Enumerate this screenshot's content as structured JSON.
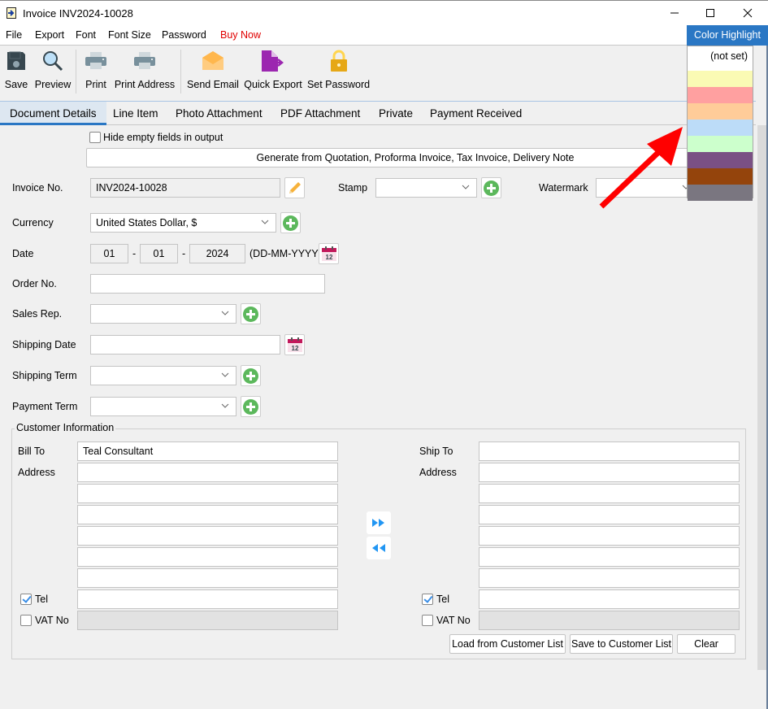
{
  "window": {
    "title": "Invoice INV2024-10028",
    "app_icon": "document-arrow-icon",
    "controls": [
      "minimize",
      "maximize",
      "close"
    ]
  },
  "menubar": {
    "items": [
      "File",
      "Export",
      "Font",
      "Font Size",
      "Password"
    ],
    "buy_now": "Buy Now",
    "color_highlight": "Color Highlight"
  },
  "toolbar": {
    "buttons": [
      {
        "label": "Save",
        "icon": "floppy-disk-icon"
      },
      {
        "label": "Preview",
        "icon": "magnifier-icon"
      },
      {
        "label": "Print",
        "icon": "printer-icon"
      },
      {
        "label": "Print Address",
        "icon": "printer-icon"
      },
      {
        "label": "Send Email",
        "icon": "envelope-icon"
      },
      {
        "label": "Quick Export",
        "icon": "export-document-icon"
      },
      {
        "label": "Set Password",
        "icon": "padlock-icon"
      }
    ]
  },
  "tabs": {
    "items": [
      "Document Details",
      "Line Item",
      "Photo Attachment",
      "PDF Attachment",
      "Private",
      "Payment Received"
    ],
    "active": "Document Details"
  },
  "form": {
    "hide_empty_label": "Hide empty fields in output",
    "hide_empty_checked": false,
    "generate_button": "Generate from Quotation, Proforma Invoice, Tax Invoice, Delivery Note",
    "invoice_no_label": "Invoice No.",
    "invoice_no_value": "INV2024-10028",
    "stamp_label": "Stamp",
    "stamp_value": "",
    "watermark_label": "Watermark",
    "watermark_value": "",
    "currency_label": "Currency",
    "currency_value": "United States Dollar, $",
    "date_label": "Date",
    "date_day": "01",
    "date_month": "01",
    "date_year": "2024",
    "date_sep": "-",
    "date_format": "(DD-MM-YYYY)",
    "order_no_label": "Order No.",
    "order_no_value": "",
    "sales_rep_label": "Sales Rep.",
    "sales_rep_value": "",
    "shipping_date_label": "Shipping Date",
    "shipping_date_value": "",
    "shipping_term_label": "Shipping Term",
    "shipping_term_value": "",
    "payment_term_label": "Payment Term",
    "payment_term_value": "",
    "calendar_icon_text": "12"
  },
  "customer": {
    "group_title": "Customer Information",
    "bill_to_label": "Bill To",
    "bill_to_value": "Teal Consultant",
    "bill_address_label": "Address",
    "bill_address_lines": [
      "",
      "",
      "",
      "",
      "",
      ""
    ],
    "bill_tel_label": "Tel",
    "bill_tel_checked": true,
    "bill_tel_value": "",
    "bill_vat_label": "VAT No",
    "bill_vat_checked": false,
    "bill_vat_value": "",
    "ship_to_label": "Ship To",
    "ship_to_value": "",
    "ship_address_label": "Address",
    "ship_address_lines": [
      "",
      "",
      "",
      "",
      "",
      ""
    ],
    "ship_tel_label": "Tel",
    "ship_tel_checked": true,
    "ship_tel_value": "",
    "ship_vat_label": "VAT No",
    "ship_vat_checked": false,
    "ship_vat_value": "",
    "load_button": "Load from Customer List",
    "save_button": "Save to Customer List",
    "clear_button": "Clear"
  },
  "color_highlight_dropdown": {
    "not_set_label": "(not set)",
    "colors": [
      "#fafab4",
      "#ffa0a0",
      "#ffcc99",
      "#bcdcf8",
      "#ccffcc",
      "#7a5084",
      "#94440c",
      "#7a7680"
    ]
  },
  "annotation": {
    "arrow_color": "#ff0000"
  }
}
